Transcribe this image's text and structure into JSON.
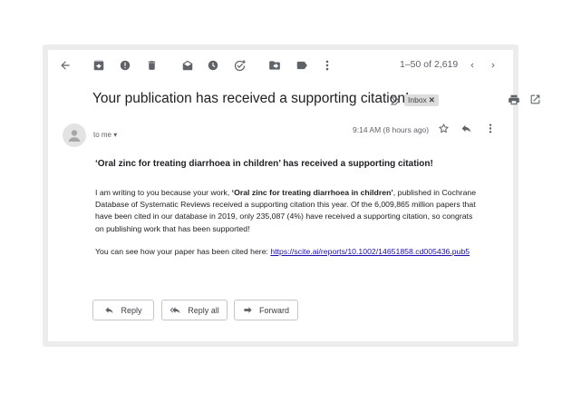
{
  "toolbar": {
    "icons": [
      "back-arrow-icon",
      "archive-icon",
      "report-spam-icon",
      "delete-icon",
      "mark-unread-icon",
      "snooze-icon",
      "add-task-icon",
      "move-to-icon",
      "label-icon",
      "more-vert-icon"
    ],
    "count": "1–50 of 2,619"
  },
  "email": {
    "subject": "Your publication has received a supporting citation!",
    "label": "Inbox",
    "recipient": "to me",
    "time": "9:14 AM (8 hours ago)",
    "heading": "‘Oral zinc for treating diarrhoea in children’ has received a supporting citation!",
    "p1_before": "I am writing to you because your work, ",
    "p1_bold": "‘Oral zinc for treating diarrhoea in children’",
    "p1_after": ", published in Cochrane Database of Systematic Reviews received a supporting citation this year. Of the 6,009,865 million papers that have been cited in our database in 2019, only 235,087 (4%) have received a supporting citation, so congrats on publishing work that has been supported!",
    "p2_text": "You can see how your paper has been cited here: ",
    "link": "https://scite.ai/reports/10.1002/14651858.cd005436.pub5"
  },
  "actions": {
    "reply": "Reply",
    "reply_all": "Reply all",
    "forward": "Forward"
  },
  "colors": {
    "icon": "#5f6368",
    "link": "#1a0dab",
    "frame": "#ececec"
  }
}
